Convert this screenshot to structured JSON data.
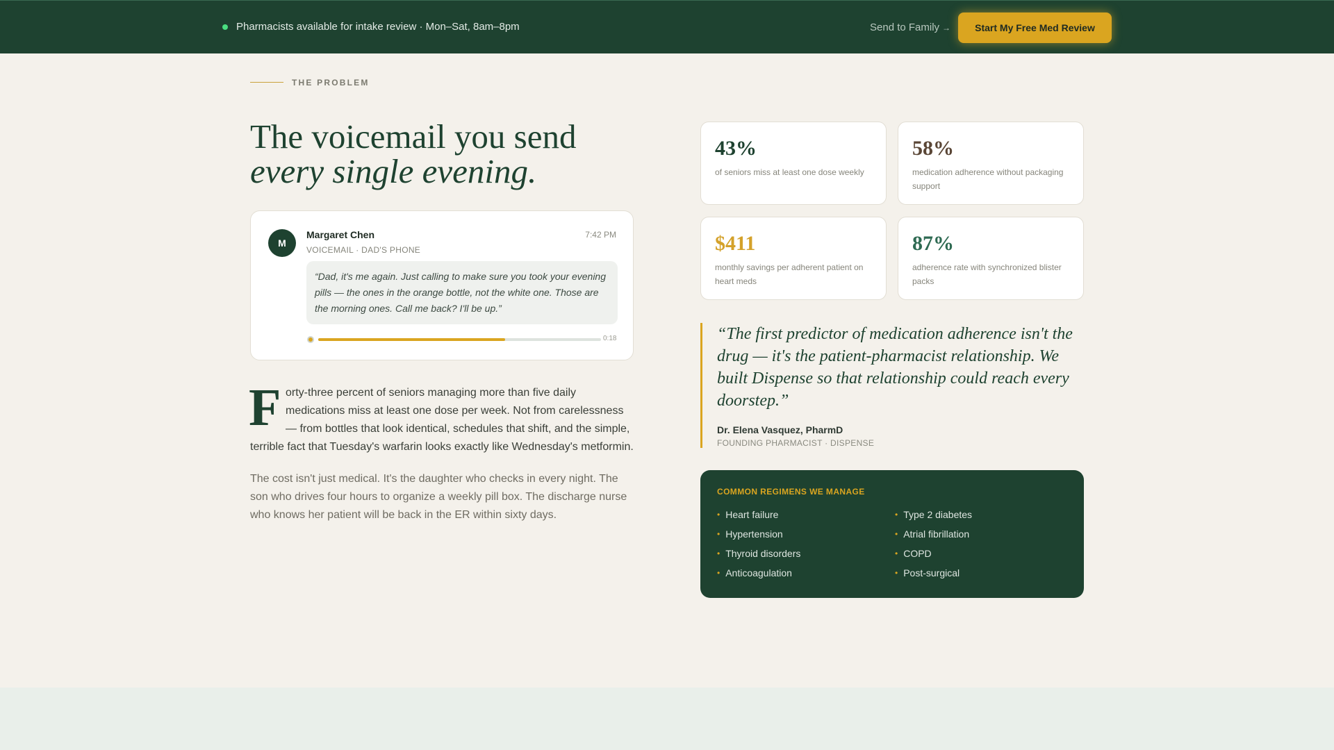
{
  "topbar": {
    "status_text": "Pharmacists available for intake review · Mon–Sat, 8am–8pm",
    "send_family_label": "Send to Family",
    "send_family_arrow": "→",
    "cta_label": "Start My Free Med Review"
  },
  "section": {
    "label": "THE PROBLEM"
  },
  "headline": {
    "line1": "The voicemail you send",
    "line2": "every single evening."
  },
  "voicemail": {
    "avatar_initial": "M",
    "caller_name": "Margaret Chen",
    "time": "7:42 PM",
    "source": "VOICEMAIL · DAD'S PHONE",
    "transcript": "“Dad, it's me again. Just calling to make sure you took your evening pills — the ones in the orange bottle, not the white one. Those are the morning ones. Call me back? I'll be up.”",
    "duration": "0:18",
    "progress": 0.66
  },
  "body": {
    "dropcap": "F",
    "para1_rest": "orty-three percent of seniors managing more than five daily medications miss at least one dose per week. Not from carelessness — from bottles that look identical, schedules that shift, and the simple, terrible fact that Tuesday's warfarin looks exactly like Wednesday's metformin.",
    "para2": "The cost isn't just medical. It's the daughter who checks in every night. The son who drives four hours to organize a weekly pill box. The discharge nurse who knows her patient will be back in the ER within sixty days."
  },
  "stats": [
    {
      "value": "43%",
      "desc": "of seniors miss at least one dose weekly",
      "color": "#1e4230"
    },
    {
      "value": "58%",
      "desc": "medication adherence without packaging support",
      "color": "#5a4636"
    },
    {
      "value": "$411",
      "desc": "monthly savings per adherent patient on heart meds",
      "color": "#d4a12a"
    },
    {
      "value": "87%",
      "desc": "adherence rate with synchronized blister packs",
      "color": "#2e6a52"
    }
  ],
  "quote": {
    "text": "“The first predictor of medication adherence isn't the drug — it's the patient-pharmacist relationship. We built Dispense so that relationship could reach every doorstep.”",
    "author": "Dr. Elena Vasquez, PharmD",
    "role": "FOUNDING PHARMACIST · DISPENSE"
  },
  "regimens": {
    "title": "COMMON REGIMENS WE MANAGE",
    "items": [
      "Heart failure",
      "Type 2 diabetes",
      "Hypertension",
      "Atrial fibrillation",
      "Thyroid disorders",
      "COPD",
      "Anticoagulation",
      "Post-surgical"
    ]
  },
  "colors": {
    "brand_green": "#1e4230",
    "accent_gold": "#daa520",
    "status_dot": "#4ade80",
    "page_bg": "#f4f1eb"
  }
}
